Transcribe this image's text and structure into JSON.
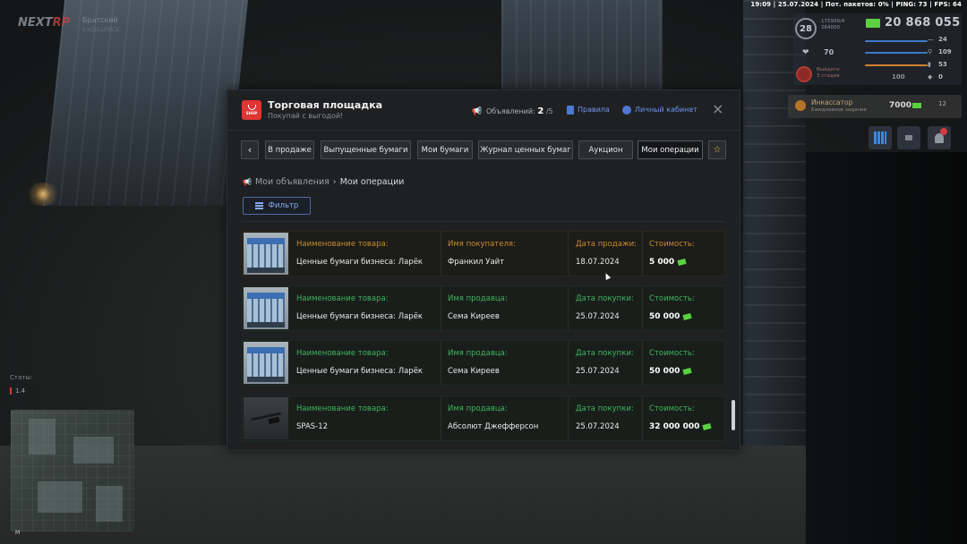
{
  "hud": {
    "topline": "19:09 | 25.07.2024 | Пот. пакетов: 0% | PING: 73 | FPS: 64",
    "logo_main": "NEXT",
    "logo_accent": "RP",
    "server_name": "Братский",
    "server_sub": "EXCELLENCE",
    "level": "28",
    "exp_line1": "175999/4",
    "exp_line2": "264000",
    "money": "20 868 055",
    "health": "70",
    "wanted_line1": "Выйдите",
    "wanted_line2": "3 стадия",
    "armor": "24",
    "food": "109",
    "water": "53",
    "stamina": "0",
    "bar_label": "100",
    "quest_title": "Инкассатор",
    "quest_sub": "Ежедневное задание",
    "quest_amount": "7000",
    "quest_level": "12",
    "stats_label": "Статы:",
    "stats_value": "1.4",
    "minimap_label": "M",
    "colors": {
      "money": "#5bd142",
      "accent_red": "#e23434",
      "link_blue": "#6c96f0"
    }
  },
  "window": {
    "title": "Торговая площадка",
    "subtitle": "Покупай с выгодой!",
    "shop_icon_text": "SHOP",
    "ads_label": "Объявлений:",
    "ads_current": "2",
    "ads_max": "/5",
    "rules_label": "Правила",
    "account_label": "Личный кабинет",
    "close_icon": "×",
    "tabs": [
      {
        "label": "‹"
      },
      {
        "label": "В продаже"
      },
      {
        "label": "Выпущенные бумаги"
      },
      {
        "label": "Мои бумаги"
      },
      {
        "label": "Журнал ценных бумаг"
      },
      {
        "label": "Аукцион"
      },
      {
        "label": "Мои операции"
      },
      {
        "label": "☆"
      }
    ],
    "active_tab": "Мои операции",
    "breadcrumb": {
      "parent": "Мои объявления",
      "separator": "›",
      "current": "Мои операции"
    },
    "filter_label": "Фильтр",
    "rows": [
      {
        "type": "sold",
        "thumb": "kiosk",
        "name_label": "Наименование товара:",
        "name": "Ценные бумаги бизнеса: Ларёк",
        "party_label": "Имя покупателя:",
        "party": "Франкил Уайт",
        "date_label": "Дата продажи:",
        "date": "18.07.2024",
        "price_label": "Стоимость:",
        "price": "5 000"
      },
      {
        "type": "bought",
        "thumb": "kiosk",
        "name_label": "Наименование товара:",
        "name": "Ценные бумаги бизнеса: Ларёк",
        "party_label": "Имя продавца:",
        "party": "Сема Киреев",
        "date_label": "Дата покупки:",
        "date": "25.07.2024",
        "price_label": "Стоимость:",
        "price": "50 000"
      },
      {
        "type": "bought",
        "thumb": "kiosk",
        "name_label": "Наименование товара:",
        "name": "Ценные бумаги бизнеса: Ларёк",
        "party_label": "Имя продавца:",
        "party": "Сема Киреев",
        "date_label": "Дата покупки:",
        "date": "25.07.2024",
        "price_label": "Стоимость:",
        "price": "50 000"
      },
      {
        "type": "bought",
        "thumb": "gun",
        "name_label": "Наименование товара:",
        "name": "SPAS-12",
        "party_label": "Имя продавца:",
        "party": "Абсолют Джефферсон",
        "date_label": "Дата покупки:",
        "date": "25.07.2024",
        "price_label": "Стоимость:",
        "price": "32 000 000"
      }
    ]
  }
}
